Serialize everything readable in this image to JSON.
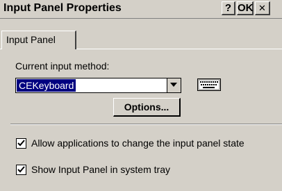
{
  "window": {
    "title": "Input Panel Properties",
    "help_label": "?",
    "ok_label": "OK",
    "close_label": "✕"
  },
  "tabs": [
    {
      "label": "Input Panel",
      "selected": true
    }
  ],
  "input_method": {
    "label": "Current input method:",
    "selected_value": "CEKeyboard"
  },
  "options_button": {
    "label": "Options..."
  },
  "checkboxes": [
    {
      "label": "Allow applications to change the input panel state",
      "checked": true
    },
    {
      "label": "Show Input Panel in system tray",
      "checked": true
    }
  ],
  "colors": {
    "face": "#d4d0c8",
    "selection": "#000080",
    "window_bg": "#ffffff"
  }
}
